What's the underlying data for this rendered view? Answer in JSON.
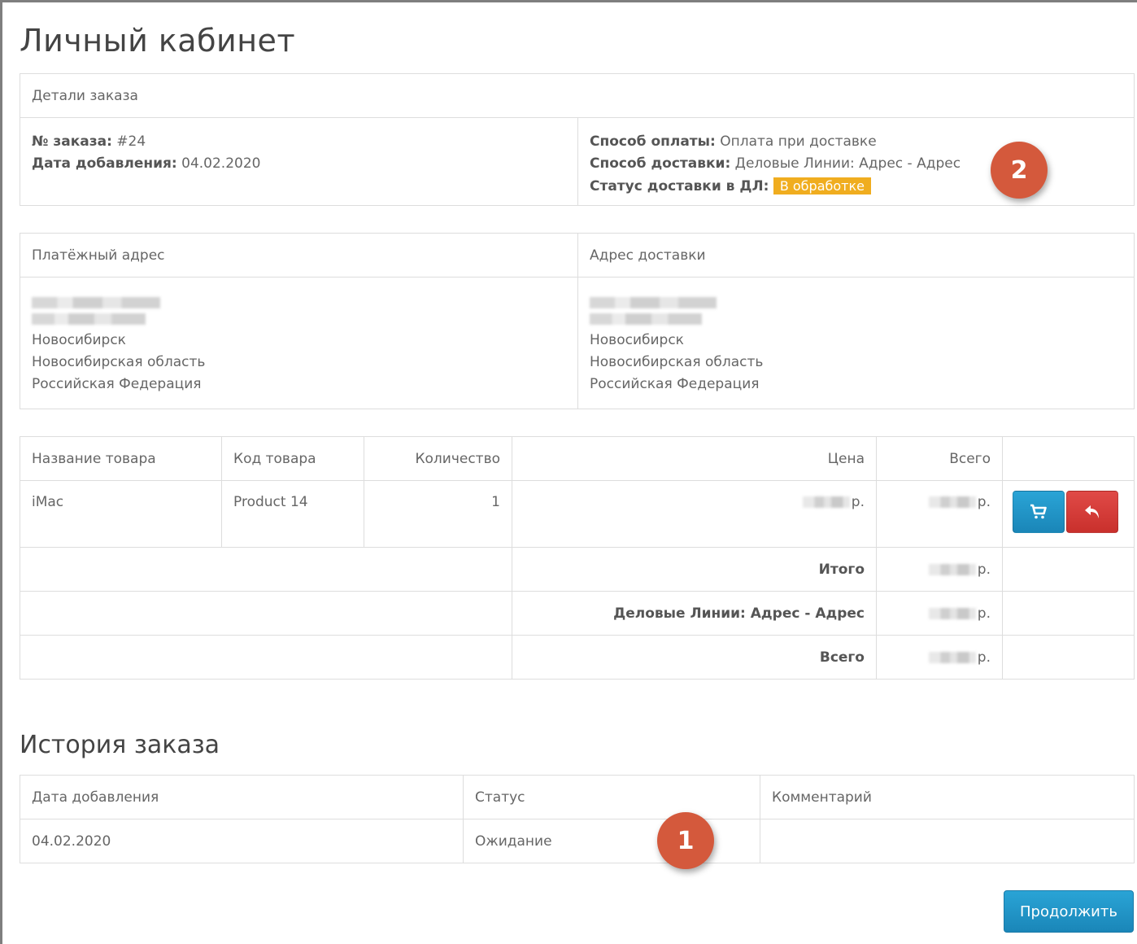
{
  "page": {
    "title": "Личный кабинет"
  },
  "order_details": {
    "header": "Детали заказа",
    "order_no_label": "№ заказа:",
    "order_no_value": "#24",
    "date_label": "Дата добавления:",
    "date_value": "04.02.2020",
    "payment_label": "Способ оплаты:",
    "payment_value": "Оплата при доставке",
    "shipping_label": "Способ доставки:",
    "shipping_value": "Деловые Линии: Адрес - Адрес",
    "status_label": "Статус доставки в ДЛ:",
    "status_value": "В обработке",
    "status_color": "#f0ad1f"
  },
  "addresses": {
    "payment_header": "Платёжный адрес",
    "shipping_header": "Адрес доставки",
    "payment": {
      "city": "Новосибирск",
      "region": "Новосибирская область",
      "country": "Российская Федерация"
    },
    "shipping": {
      "city": "Новосибирск",
      "region": "Новосибирская область",
      "country": "Российская Федерация"
    }
  },
  "products": {
    "headers": {
      "name": "Название товара",
      "model": "Код товара",
      "quantity": "Количество",
      "price": "Цена",
      "total": "Всего"
    },
    "rows": [
      {
        "name": "iMac",
        "model": "Product 14",
        "quantity": "1",
        "price_suffix": "р.",
        "total_suffix": "р."
      }
    ],
    "totals": [
      {
        "label": "Итого",
        "suffix": "р."
      },
      {
        "label": "Деловые Линии: Адрес - Адрес",
        "suffix": "р."
      },
      {
        "label": "Всего",
        "suffix": "р."
      }
    ],
    "icons": {
      "reorder": "cart-icon",
      "return": "reply-icon"
    }
  },
  "history": {
    "title": "История заказа",
    "headers": {
      "date": "Дата добавления",
      "status": "Статус",
      "comment": "Комментарий"
    },
    "rows": [
      {
        "date": "04.02.2020",
        "status": "Ожидание",
        "comment": ""
      }
    ]
  },
  "buttons": {
    "continue": "Продолжить"
  },
  "markers": {
    "one": "1",
    "two": "2",
    "color": "#d4593c"
  }
}
